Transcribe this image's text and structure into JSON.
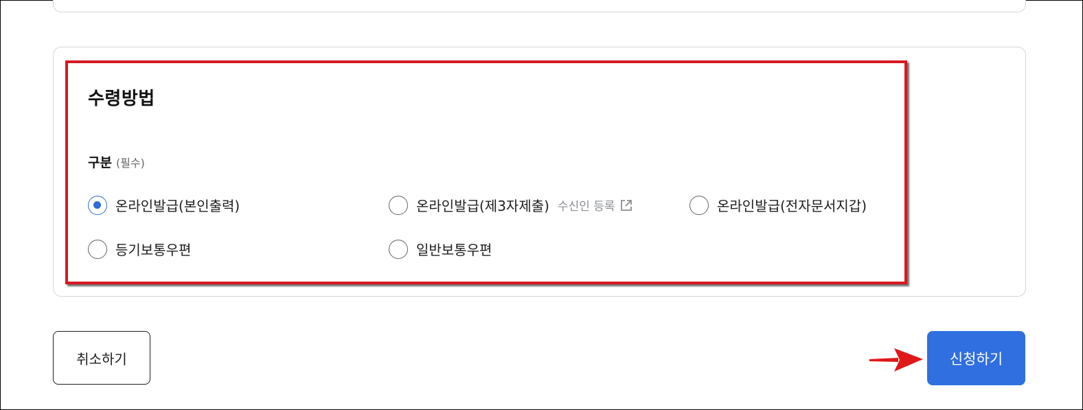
{
  "receipt": {
    "title": "수령방법",
    "field_label": "구분",
    "field_required": "(필수)",
    "options": [
      {
        "label": "온라인발급(본인출력)",
        "checked": true
      },
      {
        "label": "온라인발급(제3자제출)",
        "checked": false,
        "link_label": "수신인 등록",
        "link_icon": "external-link-icon"
      },
      {
        "label": "온라인발급(전자문서지갑)",
        "checked": false
      },
      {
        "label": "등기보통우편",
        "checked": false
      },
      {
        "label": "일반보통우편",
        "checked": false
      }
    ]
  },
  "actions": {
    "cancel_label": "취소하기",
    "submit_label": "신청하기"
  },
  "annotations": {
    "highlight_color": "#d71920",
    "arrow_color": "#e01818"
  },
  "colors": {
    "accent": "#2f6fe0",
    "radio_checked": "#2f6bd9"
  }
}
